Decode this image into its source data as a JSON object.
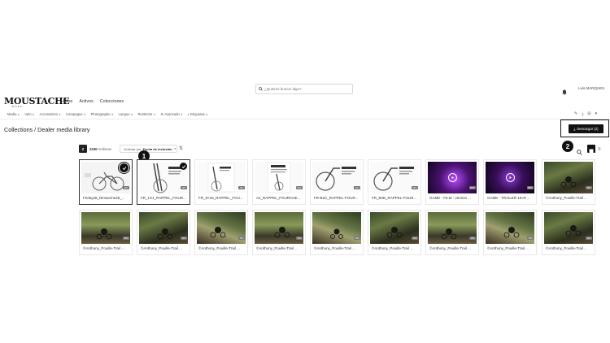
{
  "header": {
    "search_placeholder": "¿Quieres buscar algo?",
    "user_name": "Luis MARQUES"
  },
  "logo": {
    "text": "MOUSTACHE",
    "subtitle": "BIKES"
  },
  "topnav": [
    "Home",
    "Activos",
    "Colecciones"
  ],
  "filters": [
    "Media",
    "Velo",
    "Accessoires",
    "Campagne",
    "Photographe",
    "Langue",
    "Restrictor",
    "Avanzado",
    "Etiquetas"
  ],
  "breadcrumb": {
    "root": "Collections",
    "separator": " / ",
    "current": "Dealer media library"
  },
  "download_button": {
    "label": "Descargar (2)"
  },
  "toolbar": {
    "selected_count": "2",
    "file_count": "2230",
    "file_label": "Archivos",
    "sort_prefix": "Ordenar por",
    "sort_value": "Fecha de inclusión"
  },
  "markers": [
    "1",
    "2"
  ],
  "grid": {
    "row1": [
      {
        "label": "Friday28_Dimanche28_...",
        "badge": "JPG",
        "selected": true
      },
      {
        "label": "FR_1X1_RAPPEL_FOUR...",
        "badge": "JPG",
        "selected": true
      },
      {
        "label": "FR_9×16_RAPPEL_FOU...",
        "badge": "JPG",
        "selected": false
      },
      {
        "label": "A4_RAPPEL_FOURCHE...",
        "badge": "PDF",
        "selected": false
      },
      {
        "label": "FR-B2C_RAPPEL-FOUR...",
        "badge": "JPG",
        "selected": false
      },
      {
        "label": "FR_B2B_RAPPEL-FOUR...",
        "badge": "JPG",
        "selected": false
      },
      {
        "label": "GAME - FILM - version ...",
        "badge": "MP4",
        "selected": false
      },
      {
        "label": "GAME - TRAILER 16×9 ...",
        "badge": "MP4",
        "selected": false
      },
      {
        "label": "©Anthony_Pouille-Trail ...",
        "badge": "JPG",
        "selected": false
      }
    ],
    "row2": [
      {
        "label": "©Anthony_Pouille-Trail ...",
        "badge": "JPG"
      },
      {
        "label": "©Anthony_Pouille-Trail ...",
        "badge": "JPG"
      },
      {
        "label": "©Anthony_Pouille-Trail ...",
        "badge": "JPG"
      },
      {
        "label": "©Anthony_Pouille-Trail ...",
        "badge": "JPG"
      },
      {
        "label": "©Anthony_Pouille-Trail ...",
        "badge": "JPG"
      },
      {
        "label": "©Anthony_Pouille-Trail ...",
        "badge": "JPG"
      },
      {
        "label": "©Anthony_Pouille-Trail ...",
        "badge": "JPG"
      },
      {
        "label": "©Anthony_Pouille-Trail ...",
        "badge": "JPG"
      },
      {
        "label": "©Anthony_Pouille-Trail ...",
        "badge": "JPG"
      }
    ]
  }
}
